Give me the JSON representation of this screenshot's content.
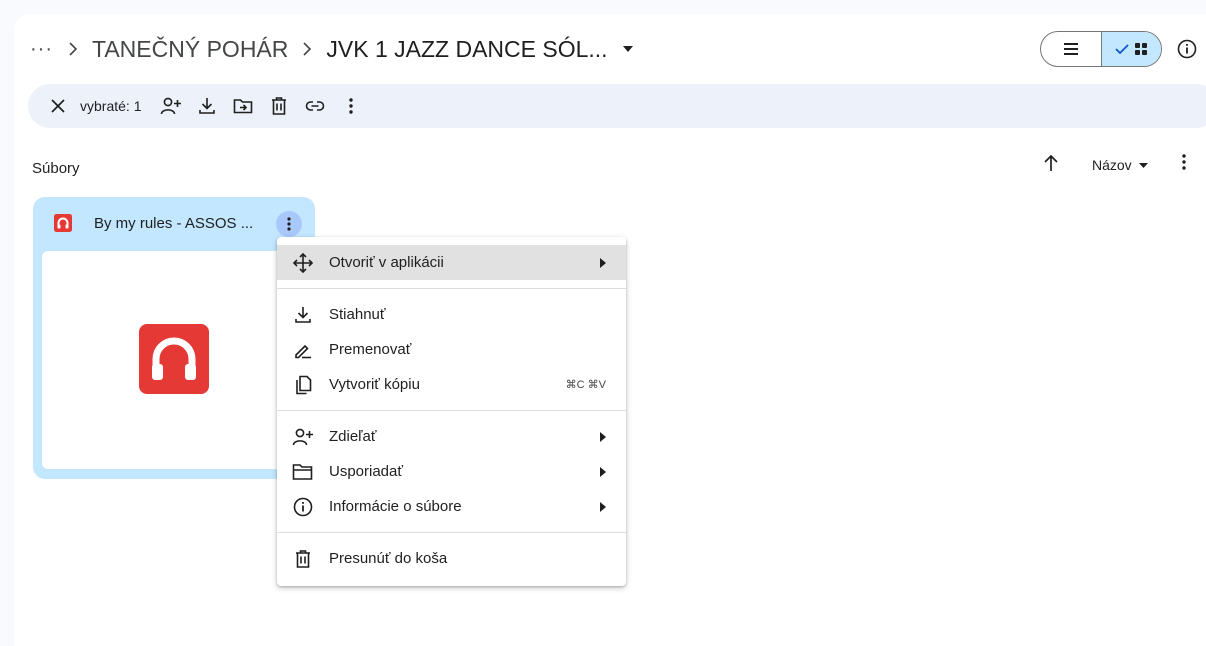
{
  "breadcrumb": {
    "more_label": "···",
    "parent": "TANEČNÝ POHÁR",
    "current": "JVK 1 JAZZ DANCE SÓL..."
  },
  "view_toggle": {
    "list_icon": "list-icon",
    "grid_icon": "grid-icon",
    "active": "grid"
  },
  "selection_bar": {
    "count_label": "vybraté: 1"
  },
  "files": {
    "title": "Súbory",
    "sort_label": "Názov"
  },
  "card": {
    "name": "By my rules - ASSOS ...",
    "file_type_icon": "audio-file-icon"
  },
  "context_menu": {
    "items": [
      {
        "label": "Otvoriť v aplikácii",
        "icon": "open-with-icon",
        "submenu": true,
        "highlighted": true
      },
      {
        "label": "Stiahnuť",
        "icon": "download-icon"
      },
      {
        "label": "Premenovať",
        "icon": "rename-icon"
      },
      {
        "label": "Vytvoriť kópiu",
        "icon": "copy-icon",
        "shortcut": "⌘C ⌘V"
      },
      {
        "label": "Zdieľať",
        "icon": "share-icon",
        "submenu": true
      },
      {
        "label": "Usporiadať",
        "icon": "folder-icon",
        "submenu": true
      },
      {
        "label": "Informácie o súbore",
        "icon": "info-icon",
        "submenu": true
      },
      {
        "label": "Presunúť do koša",
        "icon": "trash-icon"
      }
    ]
  },
  "colors": {
    "selected_card": "#c2e7ff",
    "toolbar_bg": "#edf2fa",
    "audio_icon": "#e53935",
    "menu_highlight": "#e1e1e1"
  }
}
